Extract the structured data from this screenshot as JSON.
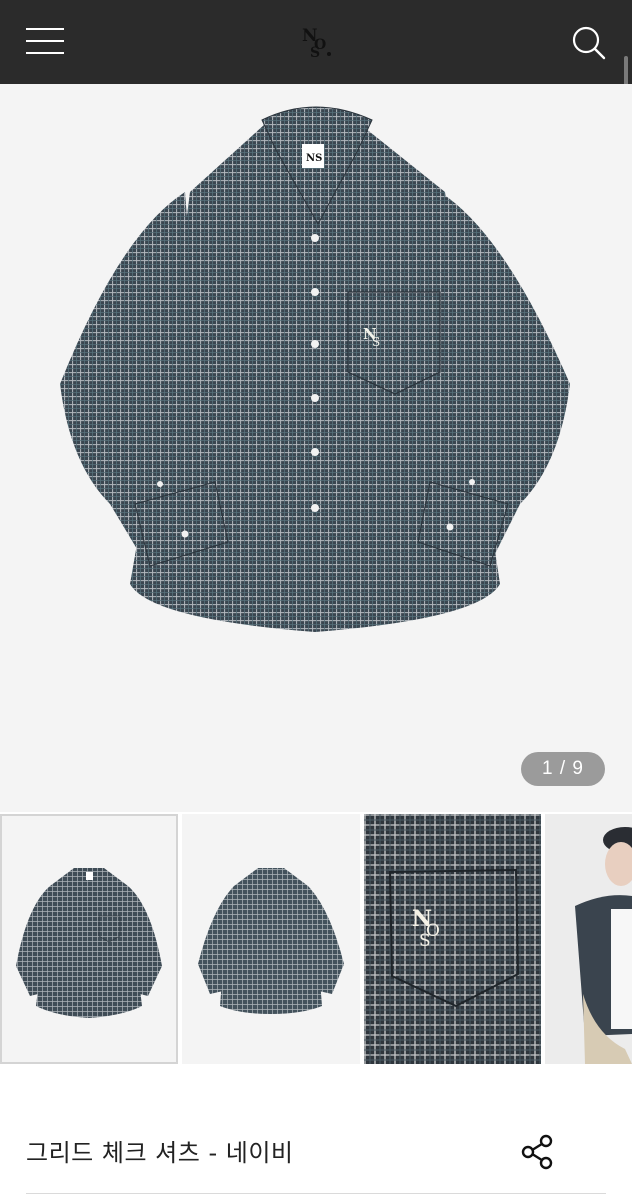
{
  "header": {
    "menu_icon": "hamburger-menu-icon",
    "logo_text": "NOS",
    "search_icon": "search-icon",
    "background": "#2b2b2b"
  },
  "gallery": {
    "counter": "1 / 9",
    "thumbnails": [
      {
        "content": "shirt front view",
        "selected": true
      },
      {
        "content": "shirt back view",
        "selected": false
      },
      {
        "content": "pocket logo detail",
        "selected": false
      },
      {
        "content": "model wearing shirt",
        "selected": false
      }
    ]
  },
  "product": {
    "name": "그리드 체크 셔츠 - 네이비",
    "share_icon": "share-icon"
  },
  "colors": {
    "shirt": "#3a4650",
    "grid_line": "#c9ced2",
    "image_bg": "#f4f4f4"
  }
}
